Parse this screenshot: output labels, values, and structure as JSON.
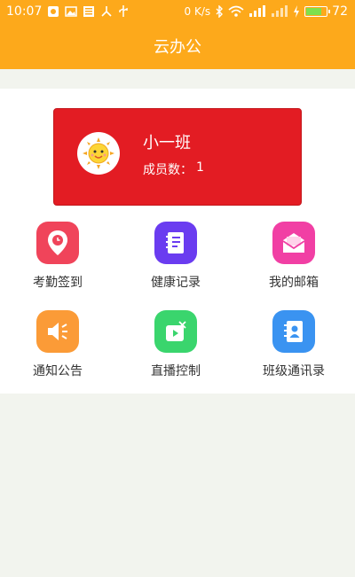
{
  "status_bar": {
    "time": "10:07",
    "data_rate": "0 K/s",
    "battery_level": "72",
    "icons": [
      "photo-icon",
      "gallery-icon",
      "news-icon",
      "share-icon",
      "usb-icon",
      "bluetooth-icon",
      "wifi-icon",
      "signal-icon",
      "charging-icon",
      "battery-icon"
    ]
  },
  "header": {
    "title": "云办公"
  },
  "class_card": {
    "name": "小一班",
    "member_label": "成员数：",
    "member_count": "1",
    "background_color": "#e31c23"
  },
  "grid": {
    "items": [
      {
        "label": "考勤签到",
        "icon": "location-clock-icon",
        "color": "#f0445a"
      },
      {
        "label": "健康记录",
        "icon": "notebook-icon",
        "color": "#6a3cf0"
      },
      {
        "label": "我的邮箱",
        "icon": "envelope-icon",
        "color": "#f13fa4"
      },
      {
        "label": "通知公告",
        "icon": "megaphone-icon",
        "color": "#fb9b37"
      },
      {
        "label": "直播控制",
        "icon": "live-play-icon",
        "color": "#3ad56d"
      },
      {
        "label": "班级通讯录",
        "icon": "address-book-icon",
        "color": "#3a93f1"
      }
    ]
  },
  "colors": {
    "accent": "#fda91b",
    "page_background": "#f2f4ee"
  }
}
